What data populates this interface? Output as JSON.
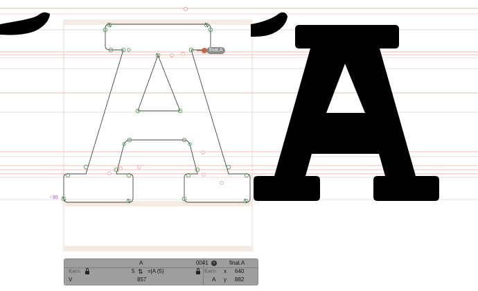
{
  "colors": {
    "metrics_line": "#e9a49b",
    "master_line": "#c7c7c7",
    "glyph_fill": "#000000",
    "point_green": "#7ab57a",
    "panel_bg": "#9e9e9e",
    "tag_bg": "#8c8c8c",
    "measurement": "#a14bd1",
    "anchor_node": "#c36a43"
  },
  "editor": {
    "anchor_label": "final.A",
    "measurement_label": "- 95"
  },
  "info_panel": {
    "glyph_name": "A",
    "unicode": "0041",
    "next_glyph": "final.A",
    "kern_label_left": "Kern",
    "left_metric": "5",
    "formula": "=|A (5)",
    "kern_label_right": "Kern",
    "x_label": "x",
    "x_value": "640",
    "left_group": "V",
    "width_value": "857",
    "right_group": "A",
    "y_label": "y",
    "y_value": "882"
  },
  "icons": [
    "lock-icon",
    "arrow-circle-icon",
    "metrics-link-icon"
  ]
}
